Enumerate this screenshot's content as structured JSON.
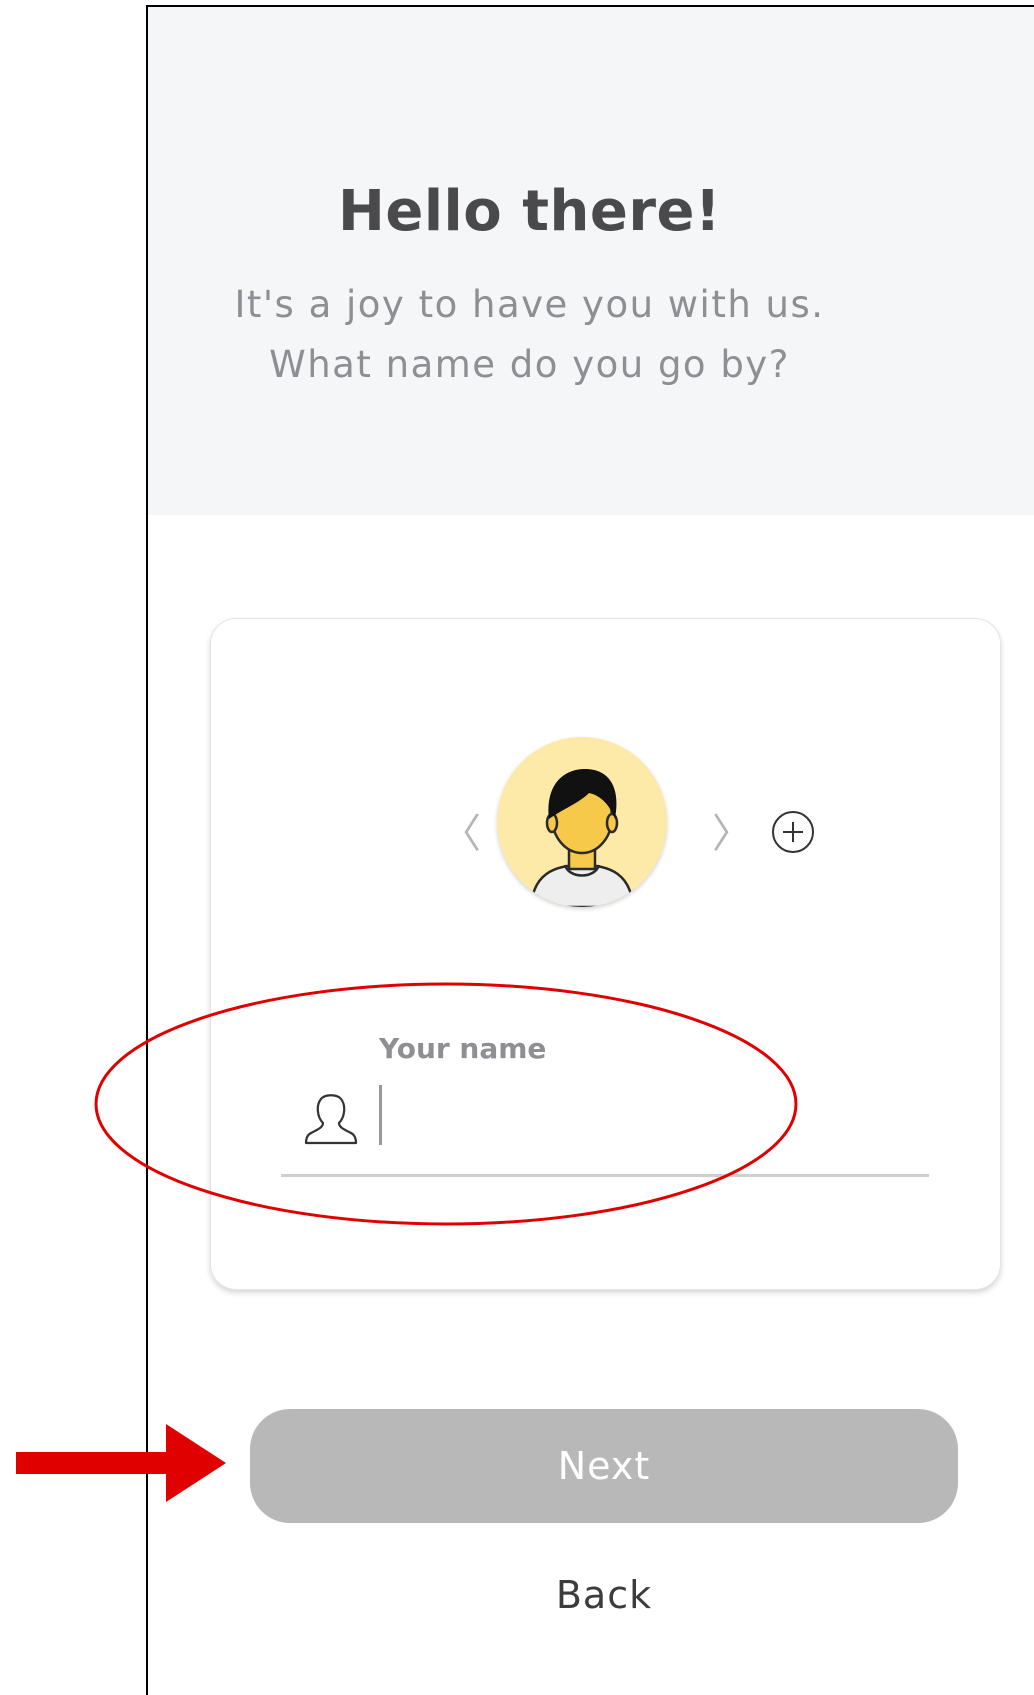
{
  "header": {
    "title": "Hello there!",
    "subtitle_line1": "It's a joy to have you with us.",
    "subtitle_line2": "What name do you go by?"
  },
  "profile_card": {
    "prev_label": "〈",
    "next_label": "〉",
    "avatar_icon": "person-avatar-icon",
    "add_icon": "plus-circle-icon",
    "name_field": {
      "label": "Your name",
      "value": "",
      "icon": "person-outline-icon"
    }
  },
  "actions": {
    "next_label": "Next",
    "back_label": "Back"
  },
  "colors": {
    "header_bg": "#f5f6f8",
    "avatar_bg": "#fde9a8",
    "next_button_disabled": "#b8b8b8",
    "annotation_red": "#e00000"
  }
}
